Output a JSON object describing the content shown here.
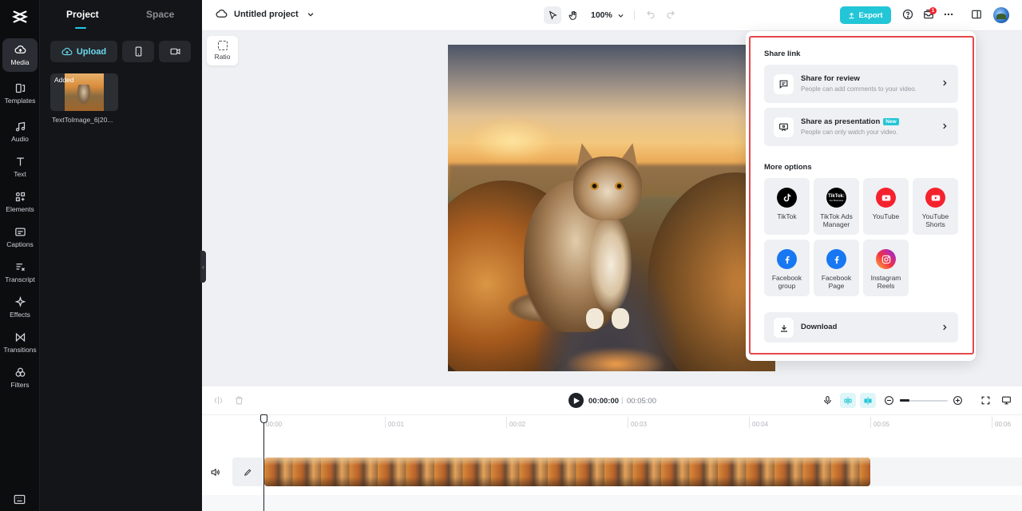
{
  "sidebar": {
    "items": [
      {
        "label": "Media",
        "icon": "media-cloud-icon",
        "active": true
      },
      {
        "label": "Templates",
        "icon": "templates-icon"
      },
      {
        "label": "Audio",
        "icon": "music-note-icon"
      },
      {
        "label": "Text",
        "icon": "text-t-icon"
      },
      {
        "label": "Elements",
        "icon": "elements-icon"
      },
      {
        "label": "Captions",
        "icon": "captions-icon"
      },
      {
        "label": "Transcript",
        "icon": "transcript-icon"
      },
      {
        "label": "Effects",
        "icon": "sparkle-icon"
      },
      {
        "label": "Transitions",
        "icon": "transitions-icon"
      },
      {
        "label": "Filters",
        "icon": "filters-icon"
      }
    ]
  },
  "panel": {
    "tabs": [
      "Project",
      "Space"
    ],
    "active_tab": "Project",
    "upload_label": "Upload",
    "media": [
      {
        "badge": "Added",
        "name": "TextToImage_6|20..."
      }
    ]
  },
  "topbar": {
    "project_title": "Untitled project",
    "zoom": "100%",
    "export_label": "Export",
    "notification_count": "1"
  },
  "canvas": {
    "ratio_label": "Ratio"
  },
  "share": {
    "section_link": "Share link",
    "cards": [
      {
        "title": "Share for review",
        "subtitle": "People can add comments to your video.",
        "tag": ""
      },
      {
        "title": "Share as presentation",
        "subtitle": "People can only watch your video.",
        "tag": "New"
      }
    ],
    "section_more": "More options",
    "options": [
      {
        "name": "TikTok",
        "icon": "tiktok-icon"
      },
      {
        "name": "TikTok Ads Manager",
        "icon": "tiktok-ads-icon"
      },
      {
        "name": "YouTube",
        "icon": "youtube-icon"
      },
      {
        "name": "YouTube Shorts",
        "icon": "youtube-shorts-icon"
      },
      {
        "name": "Facebook group",
        "icon": "facebook-icon"
      },
      {
        "name": "Facebook Page",
        "icon": "facebook-icon"
      },
      {
        "name": "Instagram Reels",
        "icon": "instagram-icon"
      }
    ],
    "download_label": "Download",
    "tiktok_ads_logo_text": "TikTok:",
    "tiktok_ads_logo_sub": "For Business"
  },
  "timeline": {
    "current_time": "00:00:00",
    "separator": "|",
    "total_time": "00:05:00",
    "ruler": [
      "00:00",
      "00:01",
      "00:02",
      "00:03",
      "00:04",
      "00:05",
      "00:06"
    ]
  },
  "colors": {
    "accent": "#23c6d7",
    "highlight": "#e5474b",
    "youtube": "#f5222d",
    "facebook": "#1877f2"
  }
}
